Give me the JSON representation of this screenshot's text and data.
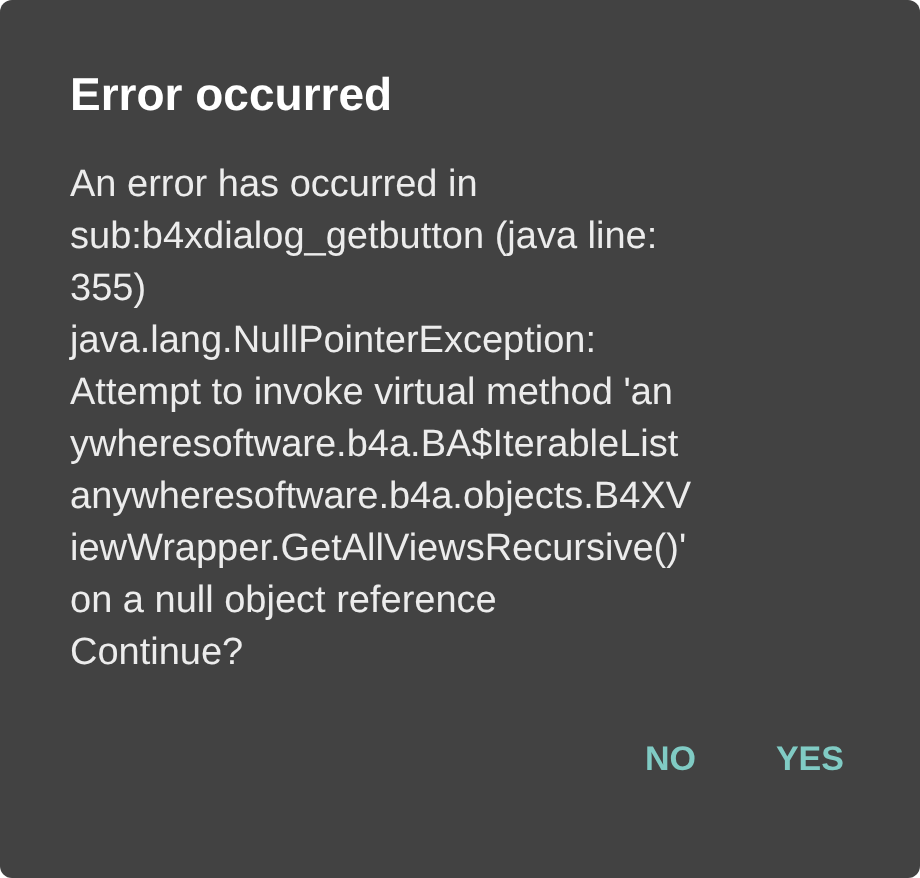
{
  "dialog": {
    "title": "Error occurred",
    "message": "An error has occurred in\nsub:b4xdialog_getbutton (java line:\n355)\njava.lang.NullPointerException:\nAttempt to invoke virtual method 'an\nywheresoftware.b4a.BA$IterableList\nanywheresoftware.b4a.objects.B4XV\niewWrapper.GetAllViewsRecursive()'\non a null object reference\nContinue?",
    "buttons": [
      "NO",
      "YES"
    ]
  }
}
